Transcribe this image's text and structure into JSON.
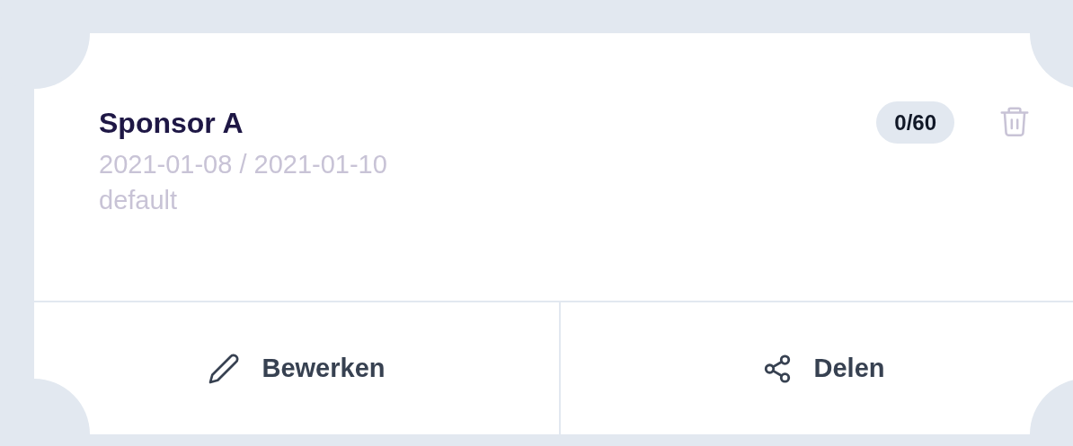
{
  "card": {
    "title": "Sponsor A",
    "dates": "2021-01-08 / 2021-01-10",
    "template": "default",
    "count": "0/60"
  },
  "actions": [
    {
      "kind": "edit",
      "label": "Bewerken"
    },
    {
      "kind": "share",
      "label": "Delen"
    }
  ]
}
